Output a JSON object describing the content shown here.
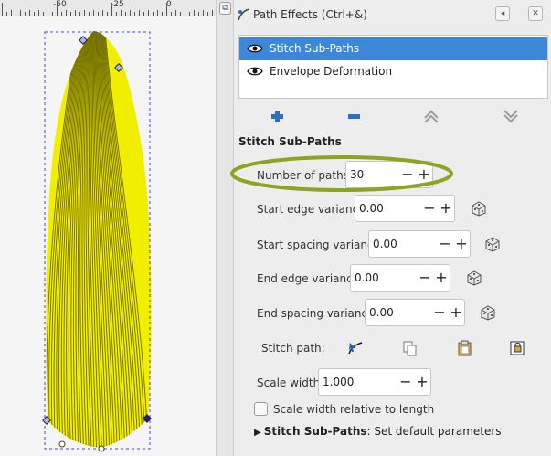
{
  "ruler": {
    "labels": [
      "-50",
      "-25",
      "0"
    ]
  },
  "dialog": {
    "title": "Path Effects (Ctrl+&)",
    "effects": [
      {
        "label": "Stitch Sub-Paths",
        "selected": true
      },
      {
        "label": "Envelope Deformation",
        "selected": false
      }
    ],
    "section_title": "Stitch Sub-Paths",
    "params": {
      "number_of_paths": {
        "label": "Number of paths:",
        "value": "30"
      },
      "start_edge_variance": {
        "label": "Start edge variance:",
        "value": "0.00"
      },
      "start_spacing_variance": {
        "label": "Start spacing variance:",
        "value": "0.00"
      },
      "end_edge_variance": {
        "label": "End edge variance:",
        "value": "0.00"
      },
      "end_spacing_variance": {
        "label": "End spacing variance:",
        "value": "0.00"
      },
      "stitch_path": {
        "label": "Stitch path:"
      },
      "scale_width": {
        "label": "Scale width:",
        "value": "1.000"
      },
      "scale_relative": {
        "label": "Scale width relative to length",
        "checked": false
      }
    },
    "footer": {
      "bold": "Stitch Sub-Paths",
      "rest": ": Set default parameters"
    },
    "spin_minus": "−",
    "spin_plus": "+"
  },
  "colors": {
    "selection": "#3c87d8",
    "shape_fill": "#f2ee00",
    "shape_stroke": "#6e6a00",
    "highlight": "#8aa51f",
    "add_icon": "#2f6fc2"
  },
  "icons": [
    "eye-icon",
    "add-icon",
    "remove-icon",
    "move-up-icon",
    "move-down-icon",
    "randomize-icon",
    "edit-path-icon",
    "copy-icon",
    "paste-icon",
    "link-icon",
    "close-icon",
    "float-icon",
    "expander-icon"
  ]
}
